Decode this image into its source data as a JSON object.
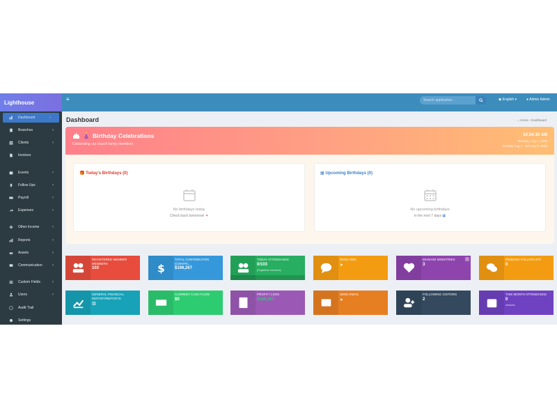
{
  "brand": "Lighthouse",
  "sidebar": {
    "items": [
      {
        "label": "Dashboard",
        "icon": "dashboard-icon",
        "chevron": "‹",
        "active": true
      },
      {
        "label": "Branches",
        "icon": "building-icon",
        "chevron": "‹"
      },
      {
        "label": "Clients",
        "icon": "users-icon",
        "chevron": "‹"
      },
      {
        "label": "Invoices",
        "icon": "file-icon",
        "chevron": ""
      },
      {
        "label": "Events",
        "icon": "calendar-icon",
        "chevron": "‹"
      },
      {
        "label": "Follow Ups",
        "icon": "bell-icon",
        "chevron": "‹"
      },
      {
        "label": "Payroll",
        "icon": "money-icon",
        "chevron": "‹"
      },
      {
        "label": "Expenses",
        "icon": "share-icon",
        "chevron": "‹"
      },
      {
        "label": "Other Income",
        "icon": "plus-icon",
        "chevron": "‹"
      },
      {
        "label": "Reports",
        "icon": "bar-chart-icon",
        "chevron": "‹"
      },
      {
        "label": "Assets",
        "icon": "car-icon",
        "chevron": "‹"
      },
      {
        "label": "Communication",
        "icon": "envelope-icon",
        "chevron": "‹"
      },
      {
        "label": "Custom Fields",
        "icon": "list-icon",
        "chevron": "‹"
      },
      {
        "label": "Users",
        "icon": "user-icon",
        "chevron": "‹"
      },
      {
        "label": "Audit Trail",
        "icon": "history-icon",
        "chevron": ""
      },
      {
        "label": "Settings",
        "icon": "gear-icon",
        "chevron": ""
      }
    ]
  },
  "topbar": {
    "menu_icon": "≡",
    "search_placeholder": "Search application...",
    "language": "English",
    "user": "Admin Admin"
  },
  "page": {
    "title": "Dashboard",
    "breadcrumb_home": "Home",
    "breadcrumb_current": "Dashboard"
  },
  "birthday": {
    "title": "Birthday Celebrations",
    "subtitle": "Celebrating our church family members",
    "time": "10:54:30 AM",
    "date": "Monday, Aug 4, 2025",
    "range": "Sunday Aug 3 - Sat Aug 9, 2025",
    "today": {
      "title": "Today's Birthdays (0)",
      "empty": "No birthdays today",
      "hint": "Check back tomorrow!"
    },
    "upcoming": {
      "title": "Upcoming Birthdays (0)",
      "empty": "No upcoming birthdays",
      "hint": "in the next 7 days"
    }
  },
  "tiles": [
    {
      "label": "Registered Member Members",
      "value": "103",
      "icon": "users-icon",
      "color": "#e74c3c",
      "icon_bg": "#e74c3c"
    },
    {
      "label": "Total Contribution (Contri...",
      "value": "$106,267",
      "icon": "dollar-icon",
      "color": "#3498db",
      "icon_bg": "#3498db"
    },
    {
      "label": "Today Attendance",
      "value": "0/103",
      "note": "(Registered members)",
      "icon": "users-icon",
      "color": "#27ae60",
      "icon_bg": "#27ae60",
      "footer": true
    },
    {
      "label": "Send SMS",
      "value": "",
      "icon": "comment-icon",
      "color": "#f39c12",
      "icon_bg": "#f39c12",
      "action": true
    },
    {
      "label": "Manage Ministries",
      "value": "3",
      "icon": "heart-icon",
      "color": "#8e44ad",
      "icon_bg": "#8e44ad",
      "badge": "i"
    },
    {
      "label": "Pending Follow Ups",
      "value": "0",
      "icon": "comments-icon",
      "color": "#f39c12",
      "icon_bg": "#f39c12"
    },
    {
      "label": "General Financial Report/Reports",
      "value": "",
      "icon": "line-chart-icon",
      "color": "#17a2b8",
      "icon_bg": "#17a2b8",
      "small_icon": true
    },
    {
      "label": "Current Cash Flow",
      "value": "$0",
      "icon": "money-icon",
      "color": "#2ecc71",
      "icon_bg": "#2ecc71"
    },
    {
      "label": "Profit / Loss",
      "value": "$106,267",
      "icon": "calculator-icon",
      "color": "#9b59b6",
      "icon_bg": "#9b59b6",
      "value_color": "#2ecc71"
    },
    {
      "label": "Send Email",
      "value": "",
      "icon": "envelope-icon",
      "color": "#e67e22",
      "icon_bg": "#e67e22",
      "action": true
    },
    {
      "label": "Following Visitors",
      "value": "2",
      "icon": "user-plus-icon",
      "color": "#34495e",
      "icon_bg": "#34495e"
    },
    {
      "label": "This Month Attendance",
      "value": "0",
      "note": "sessions",
      "icon": "calendar-icon",
      "color": "#6f42c1",
      "icon_bg": "#6f42c1"
    }
  ]
}
